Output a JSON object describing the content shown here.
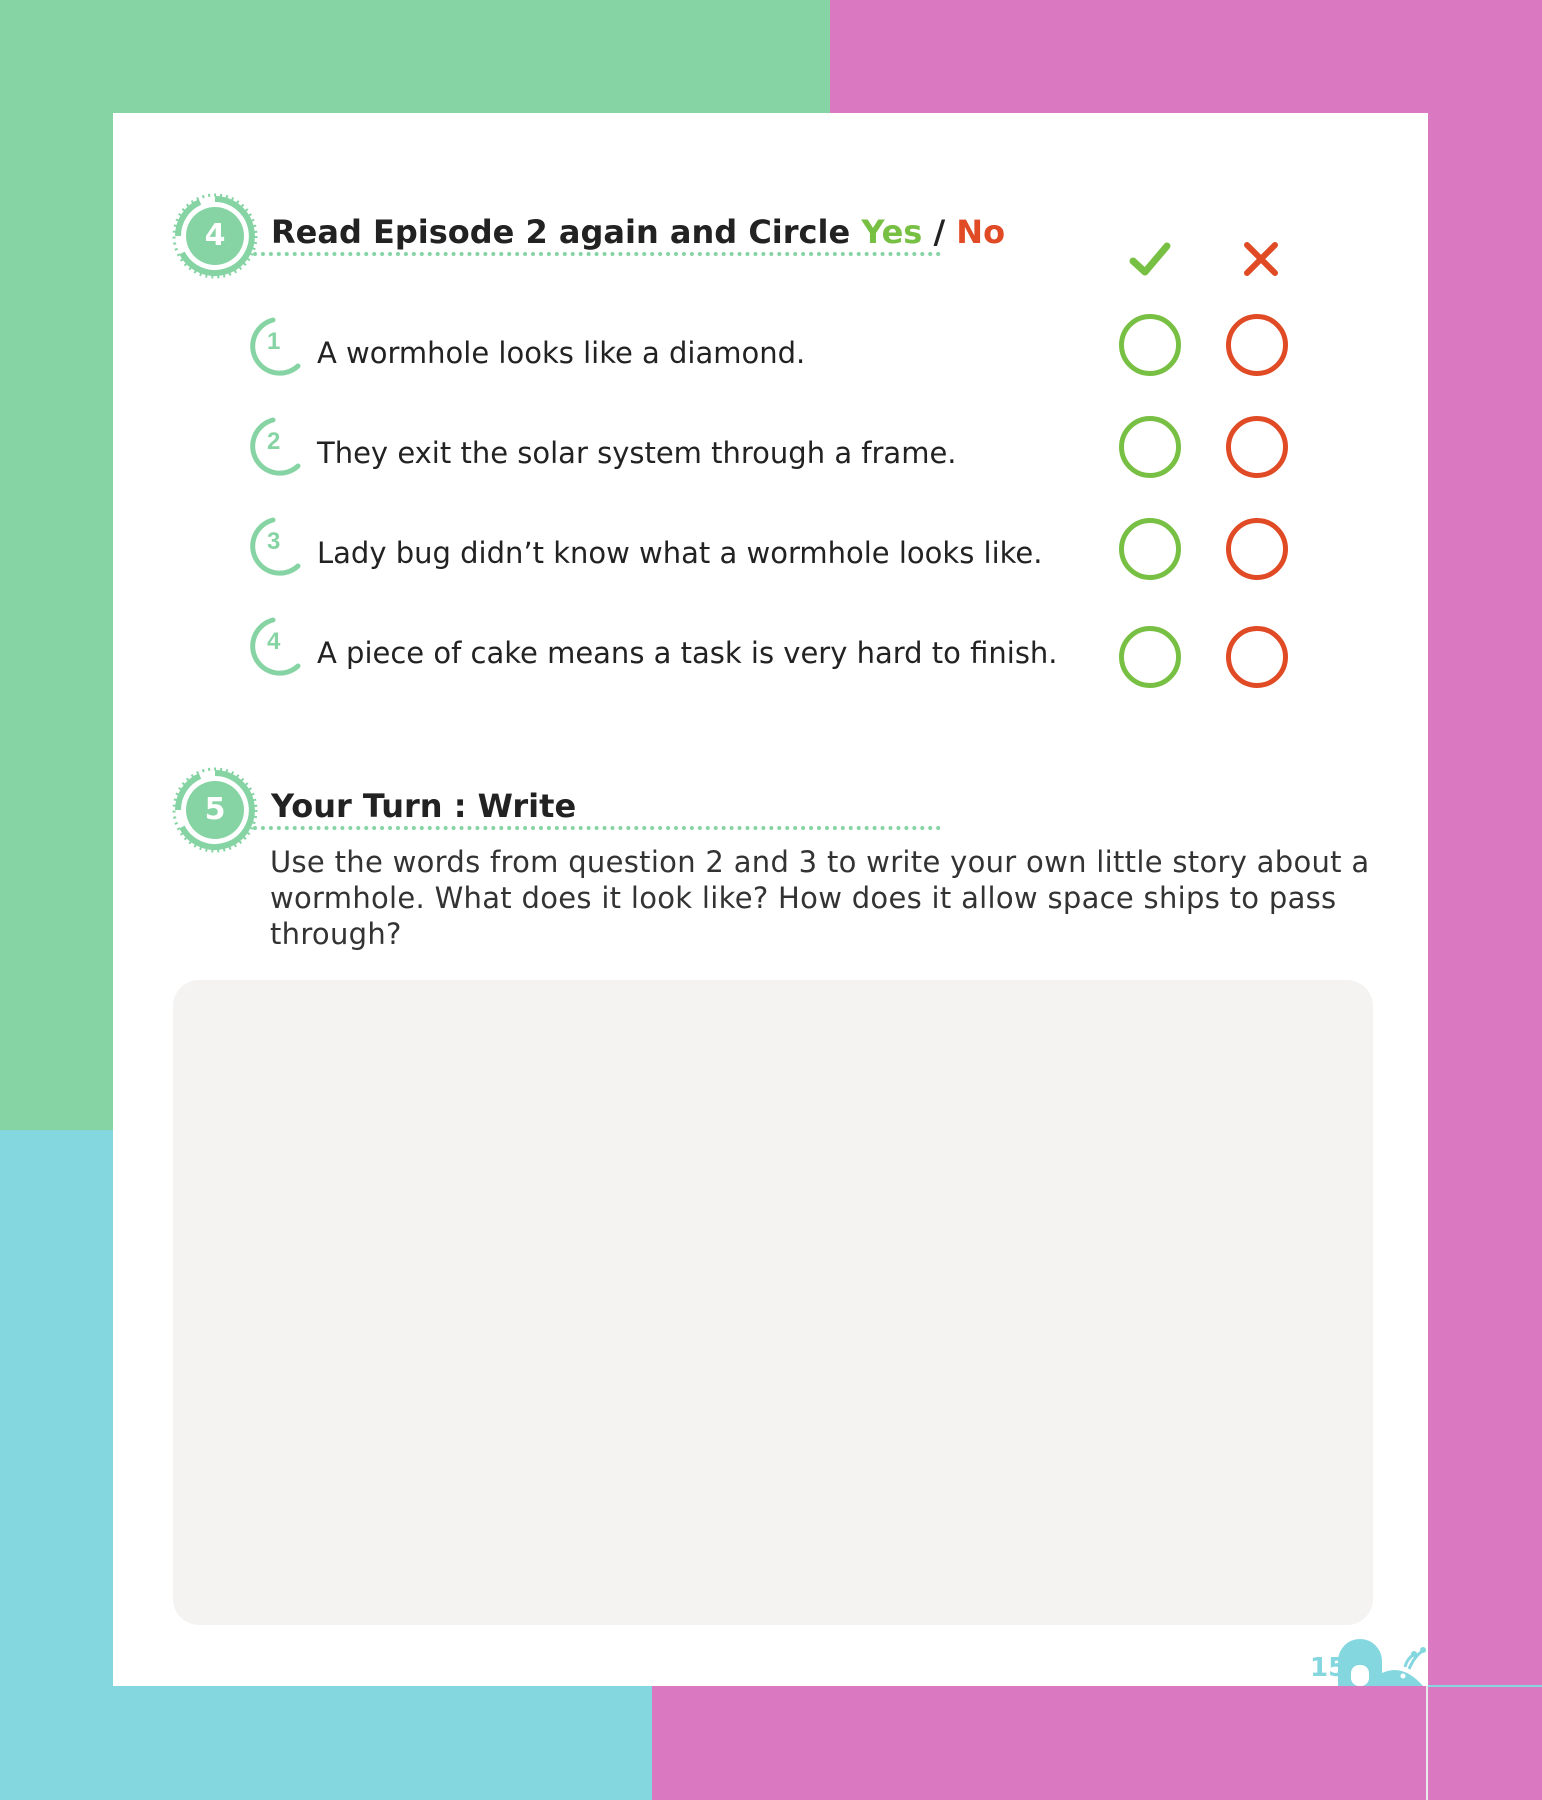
{
  "section4": {
    "number": "4",
    "title_prefix": "Read Episode 2 again and Circle ",
    "title_yes": "Yes",
    "title_slash": " / ",
    "title_no": "No",
    "yes_icon": "check-icon",
    "no_icon": "x-icon",
    "items": [
      {
        "number": "1",
        "text": "A wormhole looks like a diamond."
      },
      {
        "number": "2",
        "text": "They exit the solar system through a frame."
      },
      {
        "number": "3",
        "text": "Lady bug didn’t know what a wormhole looks like."
      },
      {
        "number": "4",
        "text": "A piece of cake means a task is very hard to finish."
      }
    ]
  },
  "section5": {
    "number": "5",
    "title": "Your Turn : Write",
    "instructions": "Use the words from question 2 and 3 to write your own little story about a wormhole. What does it look like? How does it allow space ships to pass through?"
  },
  "footer": {
    "page_number": "15"
  },
  "colors": {
    "green_bg": "#86d4a3",
    "pink_bg": "#db78c2",
    "cyan_bg": "#85d7df",
    "yes": "#77c043",
    "no": "#e04a25",
    "write_area": "#f4f3f2"
  }
}
